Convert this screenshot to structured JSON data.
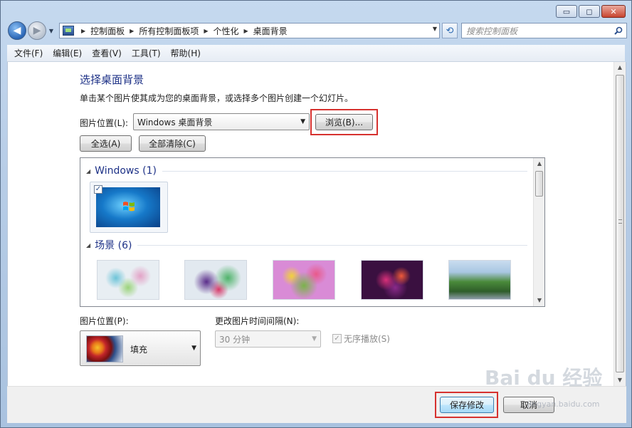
{
  "window": {
    "minimize_label": "▭",
    "maximize_label": "◻",
    "close_label": "✕"
  },
  "nav": {
    "breadcrumbs": [
      "控制面板",
      "所有控制面板项",
      "个性化",
      "桌面背景"
    ],
    "search_placeholder": "搜索控制面板"
  },
  "menu": [
    "文件(F)",
    "编辑(E)",
    "查看(V)",
    "工具(T)",
    "帮助(H)"
  ],
  "main": {
    "title": "选择桌面背景",
    "description": "单击某个图片使其成为您的桌面背景，或选择多个图片创建一个幻灯片。",
    "picture_location_label": "图片位置(L):",
    "picture_location_value": "Windows 桌面背景",
    "browse_button": "浏览(B)...",
    "select_all_button": "全选(A)",
    "clear_all_button": "全部清除(C)"
  },
  "gallery": {
    "groups": [
      {
        "title": "Windows (1)",
        "items": [
          {
            "name": "windows-7-default",
            "checked": true
          }
        ]
      },
      {
        "title": "场景 (6)",
        "items": [
          {
            "name": "scene-1",
            "colors": [
              "#e8eef3",
              "#6cc4d8",
              "#e3a3c7"
            ]
          },
          {
            "name": "scene-2",
            "colors": [
              "#e2e9f0",
              "#5a2d8a",
              "#4fb36a"
            ]
          },
          {
            "name": "scene-3",
            "colors": [
              "#d98bd6",
              "#7ab34a",
              "#4a6d2a"
            ]
          },
          {
            "name": "scene-4",
            "colors": [
              "#3a1040",
              "#d8307a",
              "#8a2a8a"
            ]
          },
          {
            "name": "scene-5",
            "colors": [
              "#c9dcef",
              "#4a8a3a",
              "#2f5d2a"
            ]
          }
        ]
      }
    ]
  },
  "position": {
    "label": "图片位置(P):",
    "value": "填充"
  },
  "interval": {
    "label": "更改图片时间间隔(N):",
    "value": "30 分钟"
  },
  "shuffle": {
    "label": "无序播放(S)",
    "checked": true,
    "disabled": true
  },
  "footer": {
    "save_button": "保存修改",
    "cancel_button": "取消"
  },
  "watermark": {
    "text": "Bai du 经验",
    "sub": "jingyan.baidu.com"
  },
  "colors": {
    "title_blue": "#1e3287",
    "highlight_red": "#d6322f"
  }
}
